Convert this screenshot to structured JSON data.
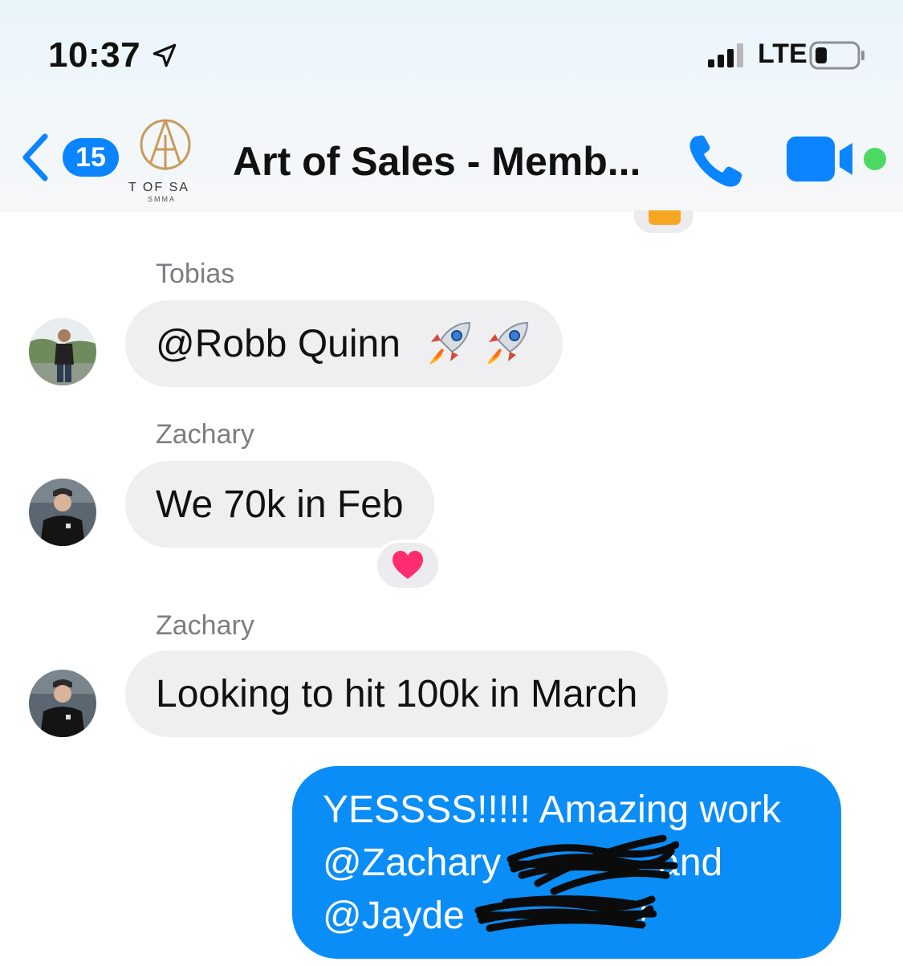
{
  "status_bar": {
    "time": "10:37",
    "network": "LTE"
  },
  "header": {
    "back_count": "15",
    "title": "Art of Sales - Memb...",
    "logo_text": "T OF SA",
    "logo_subtext": "SMMA"
  },
  "messages": [
    {
      "sender": "Tobias",
      "text": "@Robb Quinn",
      "emoji": "rocket",
      "emoji_count": 2
    },
    {
      "sender": "Zachary",
      "text": "We 70k in Feb",
      "reaction": "heart"
    },
    {
      "sender": "Zachary",
      "text": "Looking to hit 100k in March"
    }
  ],
  "outgoing": {
    "line1": "YESSSS!!!!! Amazing work",
    "line2_start": "@Zachary",
    "line2_end": "and",
    "line3_start": "@Jayde",
    "line3_end": "!"
  },
  "colors": {
    "accent": "#0a84ff",
    "outgoing_bubble": "#0a8df7",
    "incoming_bubble": "#efeff1",
    "sender_gray": "#7d7d82",
    "video_dot": "#4cd964",
    "heart": "#ff2d6f"
  },
  "icons": {
    "location": "location-arrow-icon",
    "signal": "signal-bars-icon",
    "battery": "battery-icon",
    "back": "chevron-left-icon",
    "phone": "phone-icon",
    "video": "video-camera-icon"
  }
}
